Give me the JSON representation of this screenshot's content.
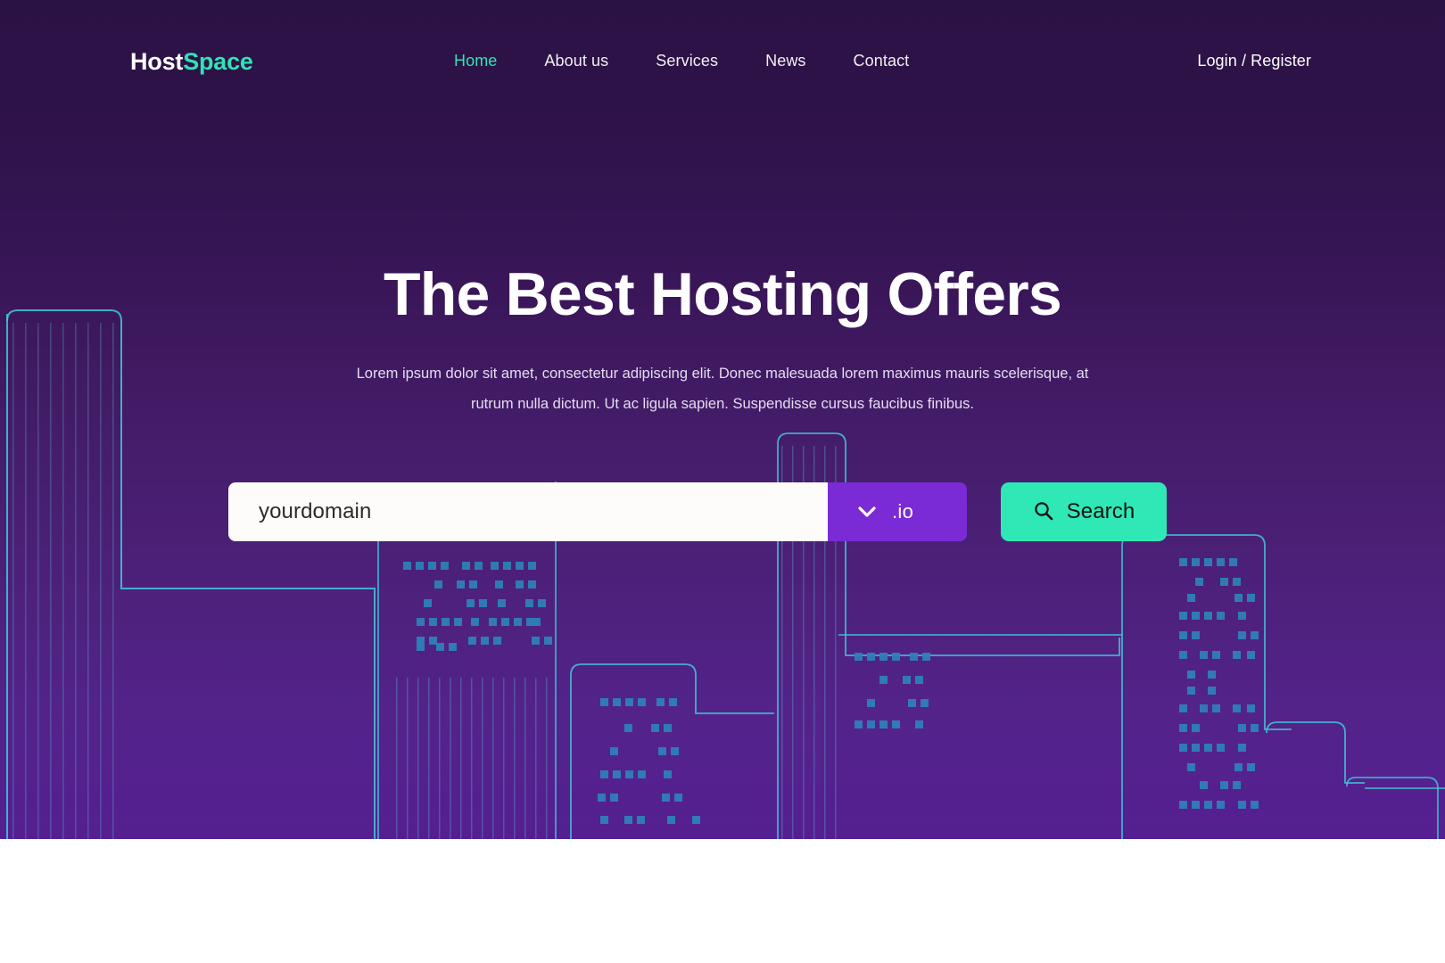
{
  "brand": {
    "name_first": "Host",
    "name_second": "Space"
  },
  "nav": {
    "items": [
      {
        "label": "Home",
        "active": true
      },
      {
        "label": "About us",
        "active": false
      },
      {
        "label": "Services",
        "active": false
      },
      {
        "label": "News",
        "active": false
      },
      {
        "label": "Contact",
        "active": false
      }
    ],
    "auth_label": "Login / Register"
  },
  "hero": {
    "title": "The Best Hosting Offers",
    "subtitle_line1": "Lorem ipsum dolor sit amet, consectetur adipiscing elit. Donec malesuada lorem maximus mauris scelerisque, at",
    "subtitle_line2": "rutrum nulla dictum. Ut ac ligula sapien. Suspendisse cursus faucibus finibus."
  },
  "search": {
    "domain_value": "yourdomain",
    "domain_placeholder": "yourdomain",
    "tld_selected": ".io",
    "tld_icon": "chevron-down-icon",
    "button_label": "Search",
    "button_icon": "search-icon"
  },
  "colors": {
    "accent_teal": "#2fe3b4",
    "button_teal": "#2fe8b6",
    "tld_purple": "#7a2bd6",
    "hero_top": "#2b1245",
    "hero_bottom": "#551f91",
    "outline_cyan": "#3fc9d8",
    "window_dot": "#2f7fb8",
    "text_white": "#ffffff",
    "input_text": "#2b2b2b"
  }
}
